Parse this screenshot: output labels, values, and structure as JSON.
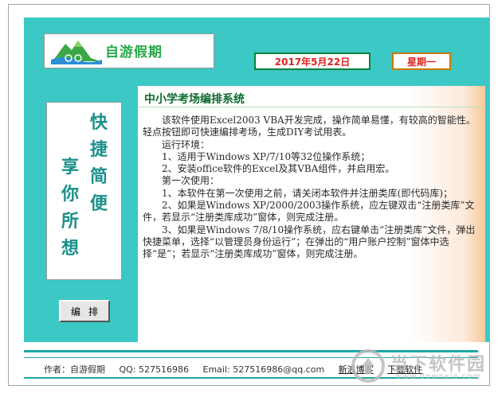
{
  "header": {
    "logo_text": "自游假期",
    "date": "2017年5月22日",
    "weekday": "星期一"
  },
  "slogan": {
    "col1": [
      "快",
      "捷",
      "简",
      "便"
    ],
    "col2": [
      "享",
      "你",
      "所",
      "想"
    ]
  },
  "sidebar": {
    "edit_button": "编排"
  },
  "main": {
    "title": "中小学考场编排系统",
    "paragraphs": [
      "该软件使用Excel2003 VBA开发完成，操作简单易懂，有较高的智能性。轻点按钮即可快速编排考场，生成DIY考试用表。",
      "运行环境：",
      "1、适用于Windows XP/7/10等32位操作系统；",
      "2、安装office软件的Excel及其VBA组件，并启用宏。",
      "第一次使用：",
      "1、本软件在第一次使用之前，请关闭本软件并注册类库(即代码库)；",
      "2、如果是Windows XP/2000/2003操作系统，应左键双击“注册类库”文件，若显示“注册类库成功”窗体，则完成注册。",
      "3、如果是Windows 7/8/10操作系统，应右键单击“注册类库”文件，弹出快捷菜单，选择“以管理员身份运行”；在弹出的“用户账户控制”窗体中选择“是”；若显示“注册类库成功”窗体，则完成注册。"
    ]
  },
  "footer": {
    "author": "作者：自游假期",
    "qq": "QQ: 527516986",
    "email": "Email: 527516986@qq.com",
    "blog_link": "新浪博客",
    "download_link": "下载软件"
  },
  "watermark": {
    "text": "当下软件园",
    "url": "www.downxia.com"
  },
  "colors": {
    "teal": "#3cc8c4",
    "title_green": "#0a6b2e",
    "date_red": "#dd2222"
  }
}
